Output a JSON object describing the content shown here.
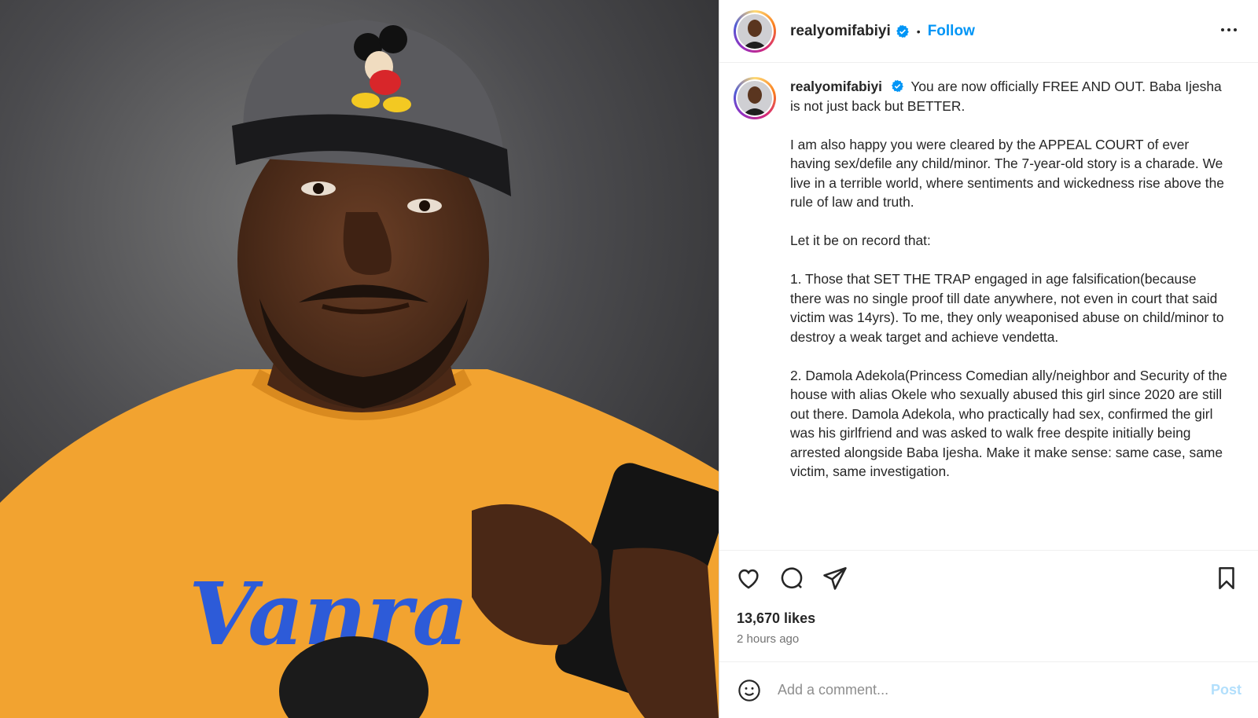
{
  "post": {
    "username": "realyomifabiyi",
    "follow_label": "Follow",
    "separator": "•",
    "caption_paragraphs": [
      "You are now officially FREE AND OUT. Baba Ijesha is not just back but BETTER.",
      "I am also happy you were cleared by the APPEAL COURT of ever having sex/defile any child/minor. The 7-year-old story is a charade. We live in a terrible world, where sentiments and wickedness rise above the rule of law and truth.",
      "Let it be on record that:",
      "1. Those that SET THE TRAP engaged in age falsification(because there was no single proof till date anywhere, not even in court that said victim was 14yrs). To me, they only weaponised abuse on child/minor to destroy a weak target and achieve vendetta.",
      "2. Damola Adekola(Princess Comedian ally/neighbor and Security of the house with alias Okele who sexually abused this girl since 2020 are still out there. Damola Adekola, who practically had sex, confirmed the girl was his girlfriend and was asked to walk free despite initially being arrested alongside Baba Ijesha. Make it make sense: same case, same victim, same investigation."
    ],
    "likes": "13,670 likes",
    "time_ago": "2 hours ago"
  },
  "comment": {
    "placeholder": "Add a comment...",
    "post_label": "Post"
  },
  "icons": {
    "verified": "verified-badge-icon",
    "more": "more-options-icon",
    "like": "heart-icon",
    "comment": "comment-icon",
    "share": "share-icon",
    "save": "bookmark-icon",
    "emoji": "emoji-icon"
  },
  "colors": {
    "accent": "#0095f6",
    "post_disabled": "#b2dffc",
    "shirt": "#f5a623",
    "cap": "#5a5a5e"
  }
}
